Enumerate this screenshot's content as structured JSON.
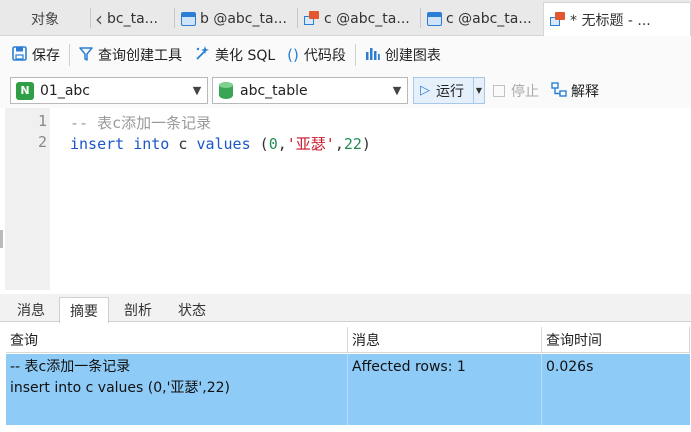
{
  "tabs": {
    "objects": "对象",
    "items": [
      {
        "label": "bc_ta...",
        "icon": "none"
      },
      {
        "label": "b @abc_ta...",
        "icon": "table-icon"
      },
      {
        "label": "c @abc_ta...",
        "icon": "query-icon"
      },
      {
        "label": "c @abc_ta...",
        "icon": "table-icon"
      },
      {
        "label": "* 无标题 - ...",
        "icon": "query-icon"
      }
    ]
  },
  "toolbar": {
    "save": "保存",
    "query_builder": "查询创建工具",
    "beautify": "美化 SQL",
    "snippet": "代码段",
    "chart": "创建图表"
  },
  "dbrow": {
    "connection": "01_abc",
    "database": "abc_table",
    "run": "运行",
    "stop": "停止",
    "explain": "解释"
  },
  "editor": {
    "lines": [
      {
        "num": "1",
        "text": "-- 表c添加一条记录"
      },
      {
        "num": "2",
        "parts": {
          "kw1": "insert",
          "kw2": "into",
          "table": "c",
          "kw3": "values",
          "open": "(",
          "n1": "0",
          "comma1": ",",
          "str": "'亚瑟'",
          "comma2": ",",
          "n2": "22",
          "close": ")"
        }
      }
    ]
  },
  "result_tabs": [
    "消息",
    "摘要",
    "剖析",
    "状态"
  ],
  "result_active_tab": "摘要",
  "results": {
    "headers": [
      "查询",
      "消息",
      "查询时间"
    ],
    "row": {
      "query": "-- 表c添加一条记录\ninsert into c values (0,'亚瑟',22)",
      "message": "Affected rows: 1",
      "time": "0.026s"
    }
  },
  "colors": {
    "accent": "#2a7fd4",
    "selected_row": "#8ecbf6",
    "keyword": "#1a57c8",
    "string": "#c8192e",
    "number": "#218c52",
    "comment": "#9a9a9a"
  }
}
